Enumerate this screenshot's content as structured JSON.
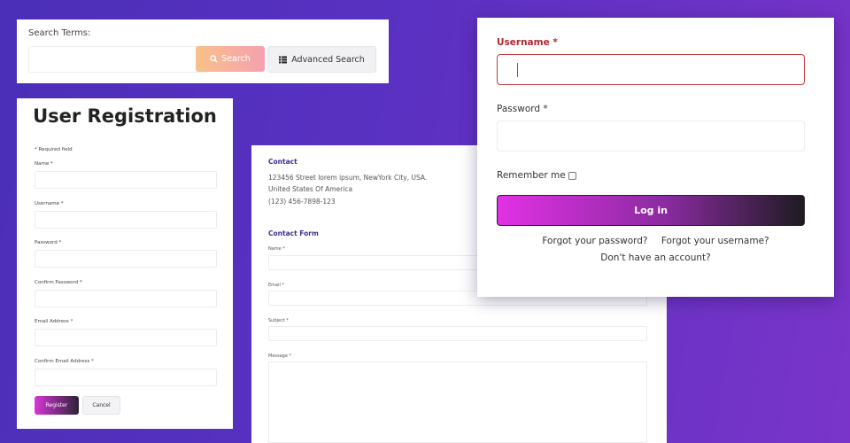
{
  "search": {
    "label": "Search Terms:",
    "input_value": "",
    "search_label": "Search",
    "advanced_label": "Advanced Search"
  },
  "registration": {
    "title": "User Registration",
    "required_note": "* Required field",
    "fields": [
      {
        "label": "Name *",
        "value": ""
      },
      {
        "label": "Username *",
        "value": ""
      },
      {
        "label": "Password *",
        "value": ""
      },
      {
        "label": "Confirm Password *",
        "value": ""
      },
      {
        "label": "Email Address *",
        "value": ""
      },
      {
        "label": "Confirm Email Address *",
        "value": ""
      }
    ],
    "register_label": "Register",
    "cancel_label": "Cancel"
  },
  "contact": {
    "heading": "Contact",
    "address_line1": "123456 Street lorem ipsum, NewYork City, USA.",
    "address_line2": "United States Of America",
    "phone": "(123) 456-7898-123",
    "form_heading": "Contact Form",
    "fields": [
      {
        "label": "Name *"
      },
      {
        "label": "Email *"
      },
      {
        "label": "Subject *"
      },
      {
        "label": "Message *"
      }
    ]
  },
  "login": {
    "username_label": "Username *",
    "password_label": "Password *",
    "remember_label": "Remember me",
    "remember_checked": false,
    "login_label": "Log in",
    "forgot_password": "Forgot your password?",
    "forgot_username": "Forgot your username?",
    "no_account": "Don't have an account?"
  }
}
